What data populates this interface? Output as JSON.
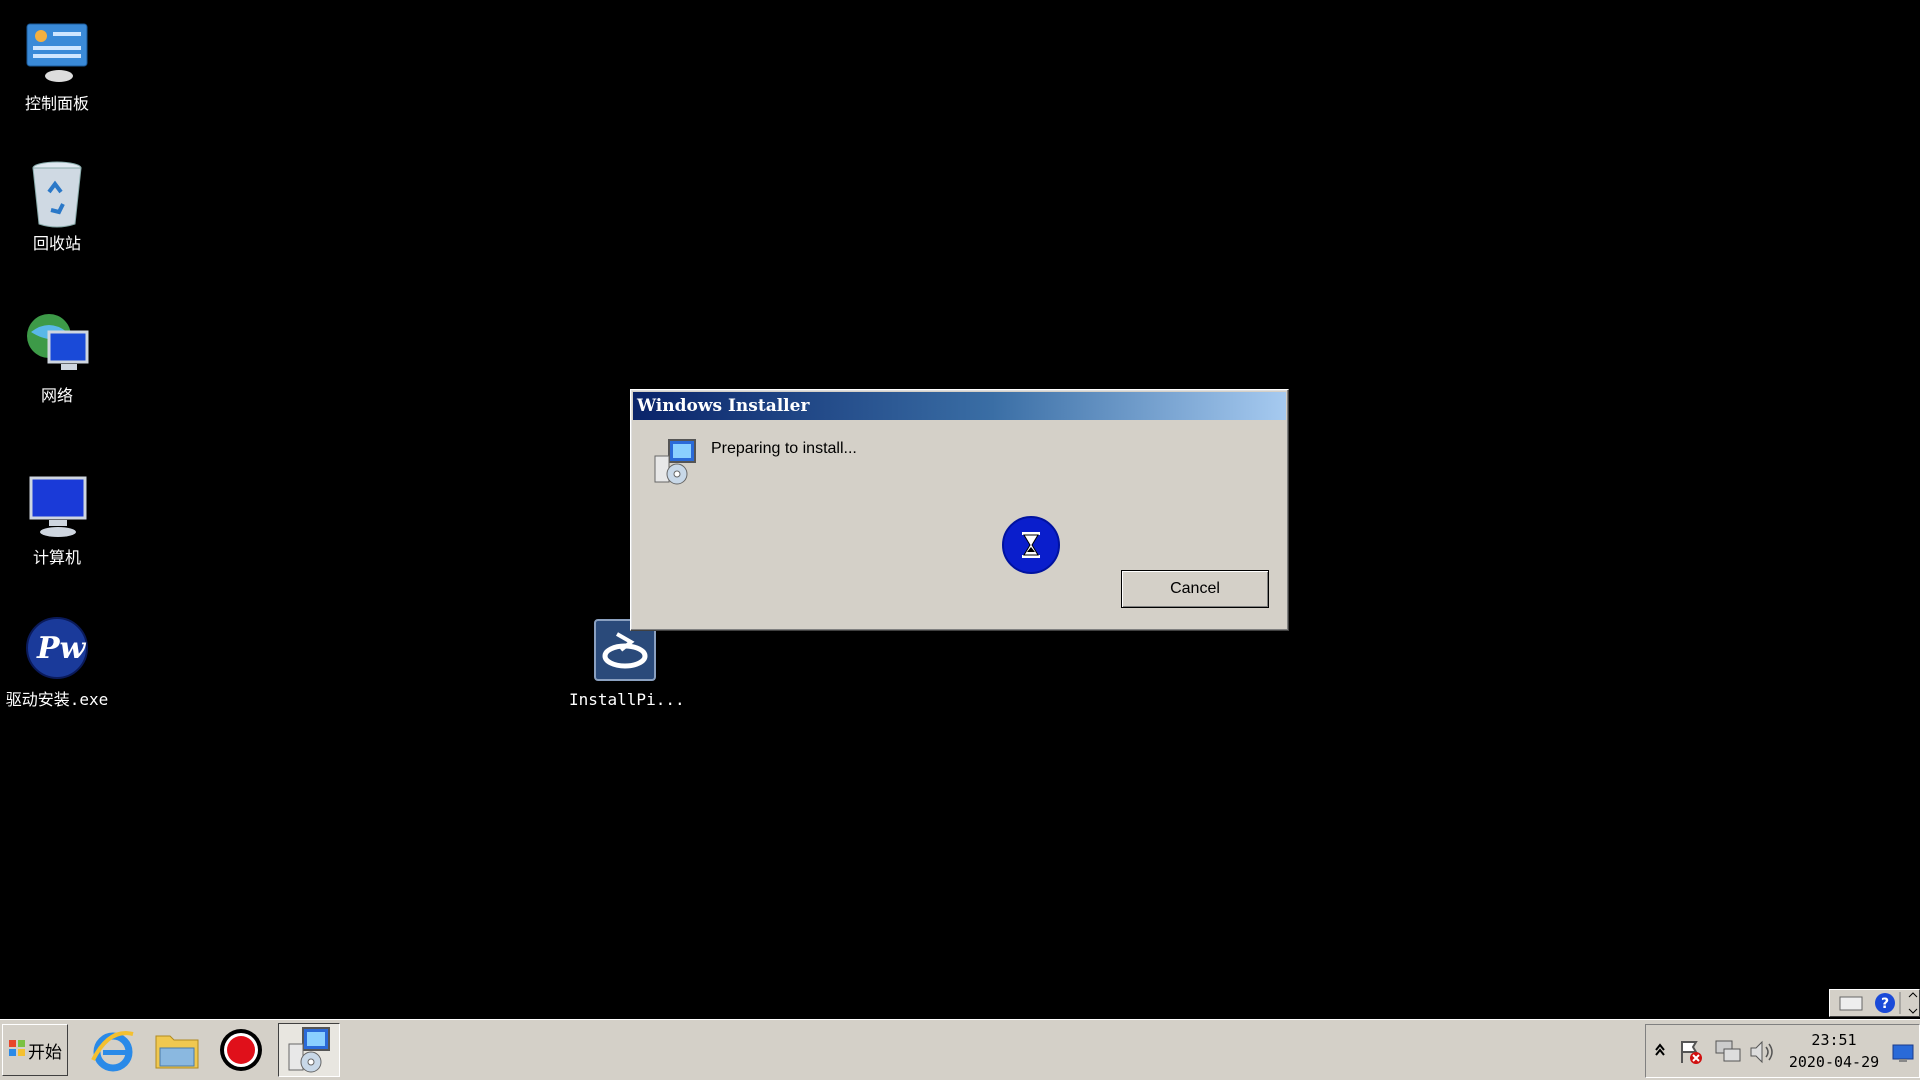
{
  "desktop": {
    "icons": [
      {
        "label": "控制面板"
      },
      {
        "label": "回收站"
      },
      {
        "label": "网络"
      },
      {
        "label": "计算机"
      },
      {
        "label": "驱动安装.exe"
      },
      {
        "label": "InstallPi..."
      }
    ]
  },
  "dialog": {
    "title": "Windows Installer",
    "message": "Preparing to install...",
    "cancel_label": "Cancel"
  },
  "taskbar": {
    "start_label": "开始",
    "apps": [
      "internet-explorer-icon",
      "file-explorer-icon",
      "record-icon",
      "windows-installer-icon"
    ]
  },
  "tray": {
    "time": "23:51",
    "date": "2020-04-29"
  },
  "colors": {
    "title_gradient_start": "#0a246a",
    "title_gradient_end": "#a6caf0",
    "dialog_bg": "#d4d0c8",
    "busy_circle": "#0a1ecc"
  }
}
